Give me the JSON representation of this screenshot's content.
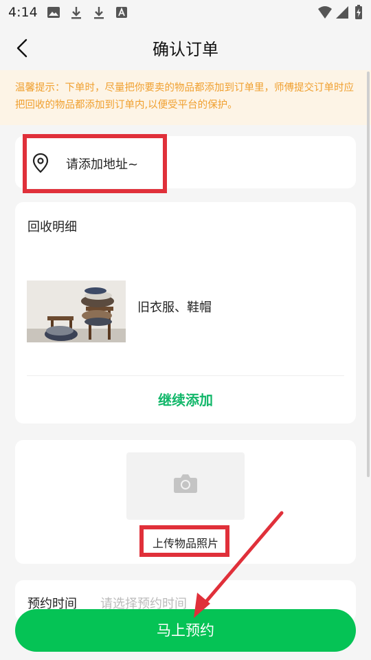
{
  "status_bar": {
    "time": "4:14"
  },
  "header": {
    "title": "确认订单"
  },
  "tip": {
    "text": "温馨提示：下单时，尽量把你要卖的物品都添加到订单里，师傅提交订单时应把回收的物品都添加到订单内,以便受平台的保护。"
  },
  "address": {
    "label": "请添加地址~"
  },
  "detail": {
    "title": "回收明细",
    "items": [
      {
        "name": "旧衣服、鞋帽"
      }
    ],
    "continue_label": "继续添加"
  },
  "photo": {
    "label": "上传物品照片"
  },
  "appointment": {
    "label": "预约时间",
    "placeholder": "请选择预约时间"
  },
  "submit": {
    "label": "马上预约"
  },
  "colors": {
    "accent": "#05c355",
    "tip_text": "#f0a030",
    "highlight": "#e0303a"
  }
}
